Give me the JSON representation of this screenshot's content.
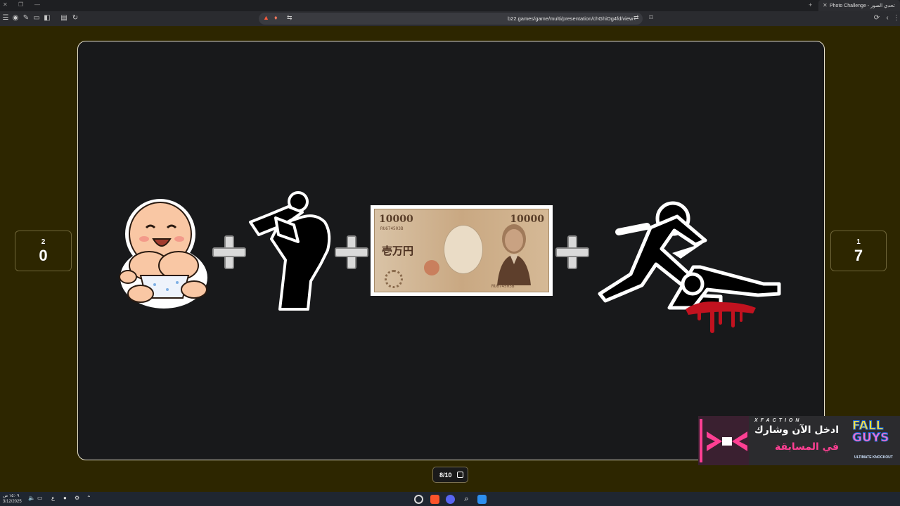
{
  "browser": {
    "tab_title": "Photo Challenge - تحدي الصور",
    "url": "b22.games/game/multi/presentation/chGhiOg4fd/view"
  },
  "scores": {
    "left": {
      "rank": "2",
      "points": "0"
    },
    "right": {
      "rank": "1",
      "points": "7"
    }
  },
  "puzzle": {
    "items": [
      "laughing-baby",
      "mother-lifting-baby-silhouette",
      "10000-yen-banknote",
      "stick-figure-stabbing-victim"
    ],
    "banknote": {
      "denomination": "10000",
      "kanji_line": "壱万円",
      "serial": "RU674503B"
    }
  },
  "pagination": {
    "label": "8/10"
  },
  "ad": {
    "brand": "XFACTION",
    "line1": "ادخل الآن وشارك",
    "line2": "في المسابقة",
    "game": "FALL",
    "game2": "GUYS",
    "subtitle": "ULTIMATE KNOCKOUT"
  },
  "taskbar": {
    "time": "١٥:٠٩ ص",
    "date": "3/12/2025",
    "lang": "ع"
  },
  "colors": {
    "page_background": "#2d2600",
    "stage_background": "#18191b",
    "stage_border": "#e9e4d0",
    "ad_accent": "#ff3f93"
  }
}
